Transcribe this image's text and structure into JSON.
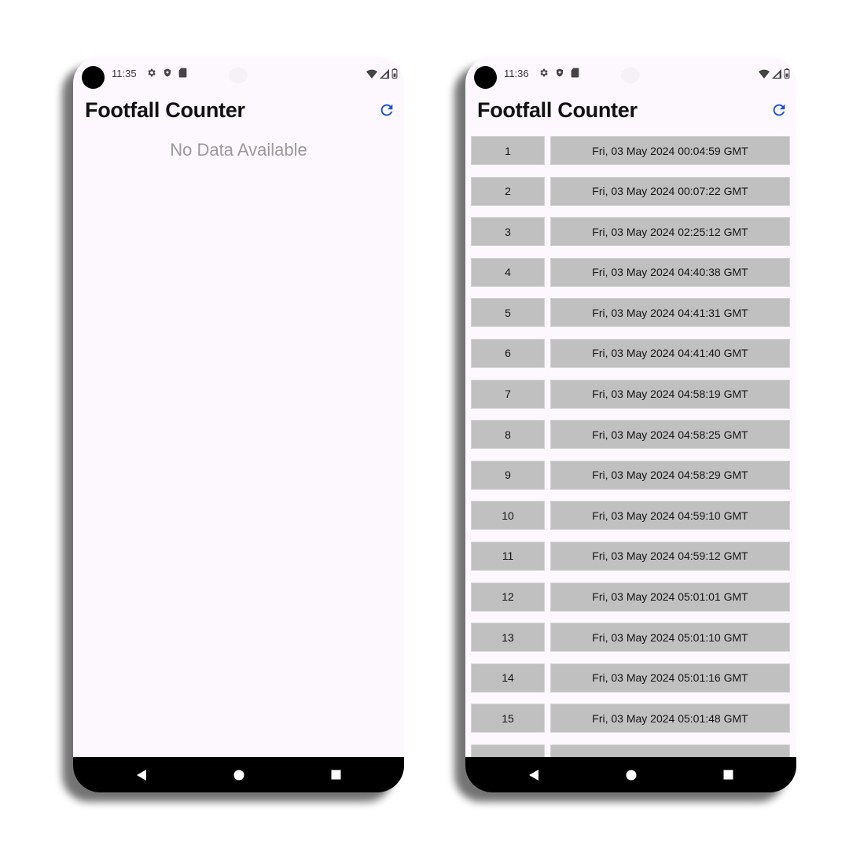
{
  "left_screen": {
    "status": {
      "time": "11:35"
    },
    "app_title": "Footfall Counter",
    "empty_message": "No Data Available"
  },
  "right_screen": {
    "status": {
      "time": "11:36"
    },
    "app_title": "Footfall Counter",
    "entries": [
      {
        "index": "1",
        "timestamp": "Fri, 03 May 2024 00:04:59 GMT"
      },
      {
        "index": "2",
        "timestamp": "Fri, 03 May 2024 00:07:22 GMT"
      },
      {
        "index": "3",
        "timestamp": "Fri, 03 May 2024 02:25:12 GMT"
      },
      {
        "index": "4",
        "timestamp": "Fri, 03 May 2024 04:40:38 GMT"
      },
      {
        "index": "5",
        "timestamp": "Fri, 03 May 2024 04:41:31 GMT"
      },
      {
        "index": "6",
        "timestamp": "Fri, 03 May 2024 04:41:40 GMT"
      },
      {
        "index": "7",
        "timestamp": "Fri, 03 May 2024 04:58:19 GMT"
      },
      {
        "index": "8",
        "timestamp": "Fri, 03 May 2024 04:58:25 GMT"
      },
      {
        "index": "9",
        "timestamp": "Fri, 03 May 2024 04:58:29 GMT"
      },
      {
        "index": "10",
        "timestamp": "Fri, 03 May 2024 04:59:10 GMT"
      },
      {
        "index": "11",
        "timestamp": "Fri, 03 May 2024 04:59:12 GMT"
      },
      {
        "index": "12",
        "timestamp": "Fri, 03 May 2024 05:01:01 GMT"
      },
      {
        "index": "13",
        "timestamp": "Fri, 03 May 2024 05:01:10 GMT"
      },
      {
        "index": "14",
        "timestamp": "Fri, 03 May 2024 05:01:16 GMT"
      },
      {
        "index": "15",
        "timestamp": "Fri, 03 May 2024 05:01:48 GMT"
      }
    ]
  },
  "icons": {
    "status_left": [
      "settings-icon",
      "shield-icon",
      "sd-card-icon"
    ],
    "status_right": [
      "wifi-icon",
      "signal-icon",
      "battery-icon"
    ],
    "refresh": "refresh-icon",
    "nav": [
      "back-icon",
      "home-icon",
      "recents-icon"
    ]
  },
  "colors": {
    "screen_background": "#fdf8fd",
    "accent": "#1a4fd6",
    "row_cell": "#c0c0c0",
    "nav_bar": "#000000",
    "empty_text": "#9a9a9a"
  }
}
